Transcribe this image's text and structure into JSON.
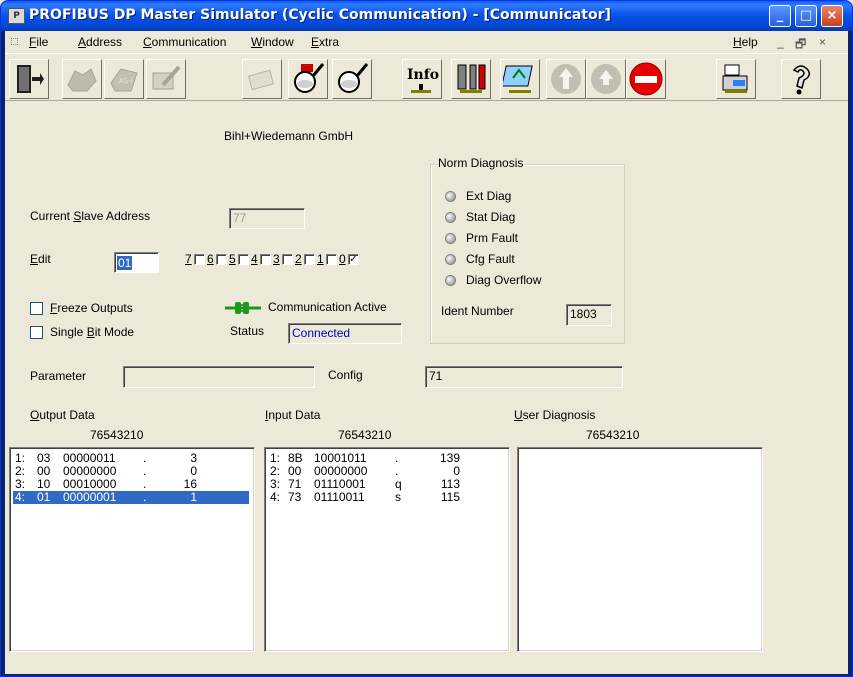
{
  "window": {
    "app_icon": "profibus-app-icon",
    "title": "PROFIBUS DP Master Simulator (Cyclic Communication) - [Communicator]",
    "controls": [
      "minimize-icon",
      "maximize-icon",
      "close-icon"
    ]
  },
  "menu": {
    "items": [
      {
        "pre": "",
        "ul": "F",
        "post": "ile"
      },
      {
        "pre": "",
        "ul": "A",
        "post": "ddress"
      },
      {
        "pre": "",
        "ul": "C",
        "post": "ommunication"
      },
      {
        "pre": "",
        "ul": "W",
        "post": "indow"
      },
      {
        "pre": "",
        "ul": "E",
        "post": "xtra"
      }
    ],
    "help": {
      "pre": "",
      "ul": "H",
      "post": "elp"
    },
    "mdi_controls": [
      "_",
      "🗗",
      "×"
    ]
  },
  "toolbar": {
    "icons": [
      {
        "name": "exit-door-icon",
        "enabled": true
      },
      {
        "name": "hands-icon",
        "enabled": false
      },
      {
        "name": "asi-module-icon",
        "enabled": false
      },
      {
        "name": "pen-write-icon",
        "enabled": false
      },
      {
        "name": "card-icon",
        "enabled": false
      },
      {
        "name": "search-slave-icon",
        "enabled": true
      },
      {
        "name": "search-icon",
        "enabled": true
      },
      {
        "name": "info-icon",
        "enabled": true,
        "text": "Info"
      },
      {
        "name": "tools-icon",
        "enabled": true
      },
      {
        "name": "network-icon",
        "enabled": true
      },
      {
        "name": "up-arrow-icon",
        "enabled": false
      },
      {
        "name": "up-arrow-small-icon",
        "enabled": false
      },
      {
        "name": "stop-icon",
        "enabled": true
      },
      {
        "name": "computer-icon",
        "enabled": true
      },
      {
        "name": "help-question-icon",
        "enabled": true
      }
    ]
  },
  "header": {
    "company": "Bihl+Wiedemann GmbH"
  },
  "slave": {
    "current_label_pre": "Current ",
    "current_label_ul": "S",
    "current_label_post": "lave Address",
    "current_value": "77",
    "edit_label_ul": "E",
    "edit_label_post": "dit",
    "edit_value": "01",
    "bits": [
      {
        "label": "7",
        "checked": false
      },
      {
        "label": "6",
        "checked": false
      },
      {
        "label": "5",
        "checked": false
      },
      {
        "label": "4",
        "checked": false
      },
      {
        "label": "3",
        "checked": false
      },
      {
        "label": "2",
        "checked": false
      },
      {
        "label": "1",
        "checked": false
      },
      {
        "label": "0",
        "checked": true
      }
    ]
  },
  "options": {
    "freeze_ul": "F",
    "freeze_post": "reeze Outputs",
    "single_pre": "Single ",
    "single_ul": "B",
    "single_post": "it Mode"
  },
  "communication": {
    "active_label": "Communication Active",
    "status_label": "Status",
    "status_value": "Connected"
  },
  "norm_diagnosis": {
    "title": "Norm Diagnosis",
    "items": [
      "Ext Diag",
      "Stat Diag",
      "Prm Fault",
      "Cfg Fault",
      "Diag Overflow"
    ],
    "ident_label": "Ident Number",
    "ident_value": "1803"
  },
  "parameter": {
    "label": "Parameter",
    "value": ""
  },
  "config": {
    "label": "Config",
    "value": "71"
  },
  "output_data": {
    "title_ul": "O",
    "title_post": "utput Data",
    "bit_header": "76543210",
    "rows": [
      {
        "idx": "1:",
        "hex": "03",
        "bin": "00000011",
        "chr": ".",
        "dec": "3",
        "selected": false
      },
      {
        "idx": "2:",
        "hex": "00",
        "bin": "00000000",
        "chr": ".",
        "dec": "0",
        "selected": false
      },
      {
        "idx": "3:",
        "hex": "10",
        "bin": "00010000",
        "chr": ".",
        "dec": "16",
        "selected": false
      },
      {
        "idx": "4:",
        "hex": "01",
        "bin": "00000001",
        "chr": ".",
        "dec": "1",
        "selected": true
      }
    ]
  },
  "input_data": {
    "title_ul": "I",
    "title_post": "nput Data",
    "bit_header": "76543210",
    "rows": [
      {
        "idx": "1:",
        "hex": "8B",
        "bin": "10001011",
        "chr": ".",
        "dec": "139"
      },
      {
        "idx": "2:",
        "hex": "00",
        "bin": "00000000",
        "chr": ".",
        "dec": "0"
      },
      {
        "idx": "3:",
        "hex": "71",
        "bin": "01110001",
        "chr": "q",
        "dec": "113"
      },
      {
        "idx": "4:",
        "hex": "73",
        "bin": "01110011",
        "chr": "s",
        "dec": "115"
      }
    ]
  },
  "user_diagnosis": {
    "title_ul": "U",
    "title_post": "ser Diagnosis",
    "bit_header": "76543210"
  }
}
